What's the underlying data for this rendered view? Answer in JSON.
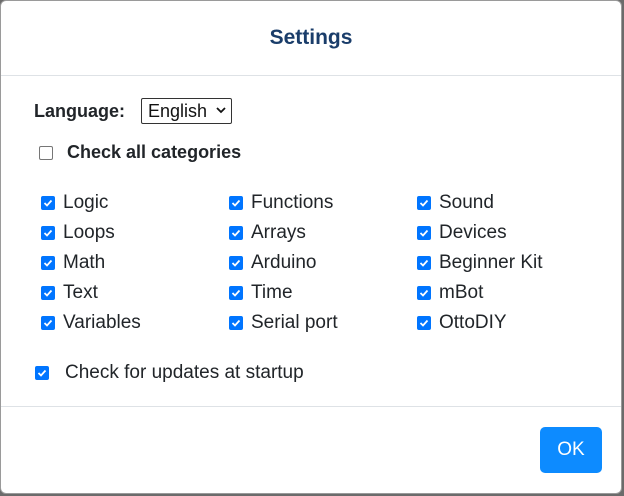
{
  "dialog": {
    "title": "Settings",
    "language_label": "Language:",
    "language_selected": "English",
    "check_all_label": "Check all categories",
    "check_all_checked": false,
    "categories": [
      {
        "label": "Logic",
        "checked": true
      },
      {
        "label": "Functions",
        "checked": true
      },
      {
        "label": "Sound",
        "checked": true
      },
      {
        "label": "Loops",
        "checked": true
      },
      {
        "label": "Arrays",
        "checked": true
      },
      {
        "label": "Devices",
        "checked": true
      },
      {
        "label": "Math",
        "checked": true
      },
      {
        "label": "Arduino",
        "checked": true
      },
      {
        "label": "Beginner Kit",
        "checked": true
      },
      {
        "label": "Text",
        "checked": true
      },
      {
        "label": "Time",
        "checked": true
      },
      {
        "label": "mBot",
        "checked": true
      },
      {
        "label": "Variables",
        "checked": true
      },
      {
        "label": "Serial port",
        "checked": true
      },
      {
        "label": "OttoDIY",
        "checked": true
      }
    ],
    "updates_label": "Check for updates at startup",
    "updates_checked": true,
    "ok_label": "OK"
  },
  "colors": {
    "title": "#1a3d6a",
    "checkbox_checked": "#0075ff",
    "ok_button": "#0d8bff"
  },
  "icons": {
    "select_arrow": "chevron-down-icon",
    "checkmark": "checkmark-icon"
  }
}
